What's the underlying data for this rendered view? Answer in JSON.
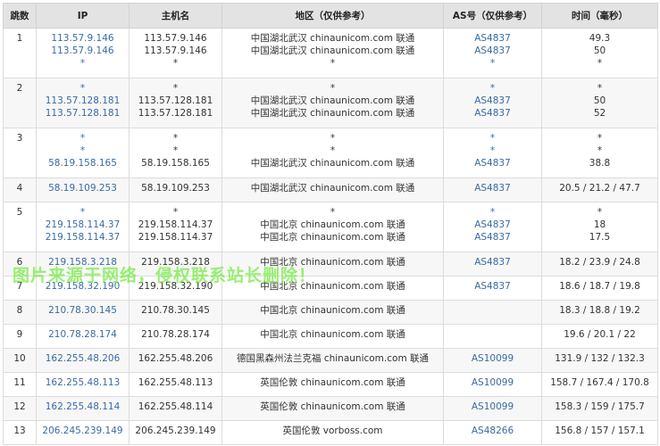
{
  "headers": [
    "跳数",
    "IP",
    "主机名",
    "地区（仅供参考）",
    "AS号（仅供参考）",
    "时间（毫秒）"
  ],
  "rows": [
    {
      "hop": "1",
      "ip": [
        "113.57.9.146",
        "113.57.9.146",
        "*"
      ],
      "host": [
        "113.57.9.146",
        "113.57.9.146",
        "*"
      ],
      "region": [
        "中国湖北武汉 chinaunicom.com 联通",
        "中国湖北武汉 chinaunicom.com 联通",
        "*"
      ],
      "as": [
        "AS4837",
        "AS4837",
        "*"
      ],
      "time": [
        "49.3",
        "50",
        "*"
      ]
    },
    {
      "hop": "2",
      "ip": [
        "*",
        "113.57.128.181",
        "113.57.128.181"
      ],
      "host": [
        "*",
        "113.57.128.181",
        "113.57.128.181"
      ],
      "region": [
        "*",
        "中国湖北武汉 chinaunicom.com 联通",
        "中国湖北武汉 chinaunicom.com 联通"
      ],
      "as": [
        "*",
        "AS4837",
        "AS4837"
      ],
      "time": [
        "*",
        "50",
        "52"
      ]
    },
    {
      "hop": "3",
      "ip": [
        "*",
        "*",
        "58.19.158.165"
      ],
      "host": [
        "*",
        "*",
        "58.19.158.165"
      ],
      "region": [
        "*",
        "*",
        "中国湖北武汉 chinaunicom.com 联通"
      ],
      "as": [
        "*",
        "*",
        "AS4837"
      ],
      "time": [
        "*",
        "*",
        "38.8"
      ]
    },
    {
      "hop": "4",
      "ip": [
        "58.19.109.253"
      ],
      "host": [
        "58.19.109.253"
      ],
      "region": [
        "中国湖北武汉 chinaunicom.com 联通"
      ],
      "as": [
        "AS4837"
      ],
      "time": [
        "20.5 / 21.2 / 47.7"
      ]
    },
    {
      "hop": "5",
      "ip": [
        "*",
        "219.158.114.37",
        "219.158.114.37"
      ],
      "host": [
        "*",
        "219.158.114.37",
        "219.158.114.37"
      ],
      "region": [
        "*",
        "中国北京 chinaunicom.com 联通",
        "中国北京 chinaunicom.com 联通"
      ],
      "as": [
        "*",
        "AS4837",
        "AS4837"
      ],
      "time": [
        "*",
        "18",
        "17.5"
      ]
    },
    {
      "hop": "6",
      "ip": [
        "219.158.3.218"
      ],
      "host": [
        "219.158.3.218"
      ],
      "region": [
        "中国北京 chinaunicom.com 联通"
      ],
      "as": [
        "AS4837"
      ],
      "time": [
        "18.2 / 23.9 / 24.8"
      ]
    },
    {
      "hop": "7",
      "ip": [
        "219.158.32.190"
      ],
      "host": [
        "219.158.32.190"
      ],
      "region": [
        "中国北京 chinaunicom.com 联通"
      ],
      "as": [
        "AS4837"
      ],
      "time": [
        "18.6 / 18.7 / 19.8"
      ]
    },
    {
      "hop": "8",
      "ip": [
        "210.78.30.145"
      ],
      "host": [
        "210.78.30.145"
      ],
      "region": [
        "中国北京 chinaunicom.com 联通"
      ],
      "as": [
        ""
      ],
      "time": [
        "18.3 / 18.8 / 19.2"
      ]
    },
    {
      "hop": "9",
      "ip": [
        "210.78.28.174"
      ],
      "host": [
        "210.78.28.174"
      ],
      "region": [
        "中国北京 chinaunicom.com 联通"
      ],
      "as": [
        ""
      ],
      "time": [
        "19.6 / 20.1 / 22"
      ]
    },
    {
      "hop": "10",
      "ip": [
        "162.255.48.206"
      ],
      "host": [
        "162.255.48.206"
      ],
      "region": [
        "德国黑森州法兰克福 chinaunicom.com 联通"
      ],
      "as": [
        "AS10099"
      ],
      "time": [
        "131.9 / 132 / 132.3"
      ]
    },
    {
      "hop": "11",
      "ip": [
        "162.255.48.113"
      ],
      "host": [
        "162.255.48.113"
      ],
      "region": [
        "英国伦敦 chinaunicom.com 联通"
      ],
      "as": [
        "AS10099"
      ],
      "time": [
        "158.7 / 167.4 / 170.8"
      ]
    },
    {
      "hop": "12",
      "ip": [
        "162.255.48.114"
      ],
      "host": [
        "162.255.48.114"
      ],
      "region": [
        "英国伦敦 chinaunicom.com 联通"
      ],
      "as": [
        "AS10099"
      ],
      "time": [
        "158.3 / 159 / 175.7"
      ]
    },
    {
      "hop": "13",
      "ip": [
        "206.245.239.149"
      ],
      "host": [
        "206.245.239.149"
      ],
      "region": [
        "英国伦敦 vorboss.com"
      ],
      "as": [
        "AS48266"
      ],
      "time": [
        "156.8 / 157 / 157.1"
      ]
    }
  ],
  "watermark": "图片来源于网络，侵权联系站长删除！",
  "colors": {
    "link": "#3a6aa3",
    "header_bg": "#e3e3e3",
    "watermark": "#78eb46"
  }
}
